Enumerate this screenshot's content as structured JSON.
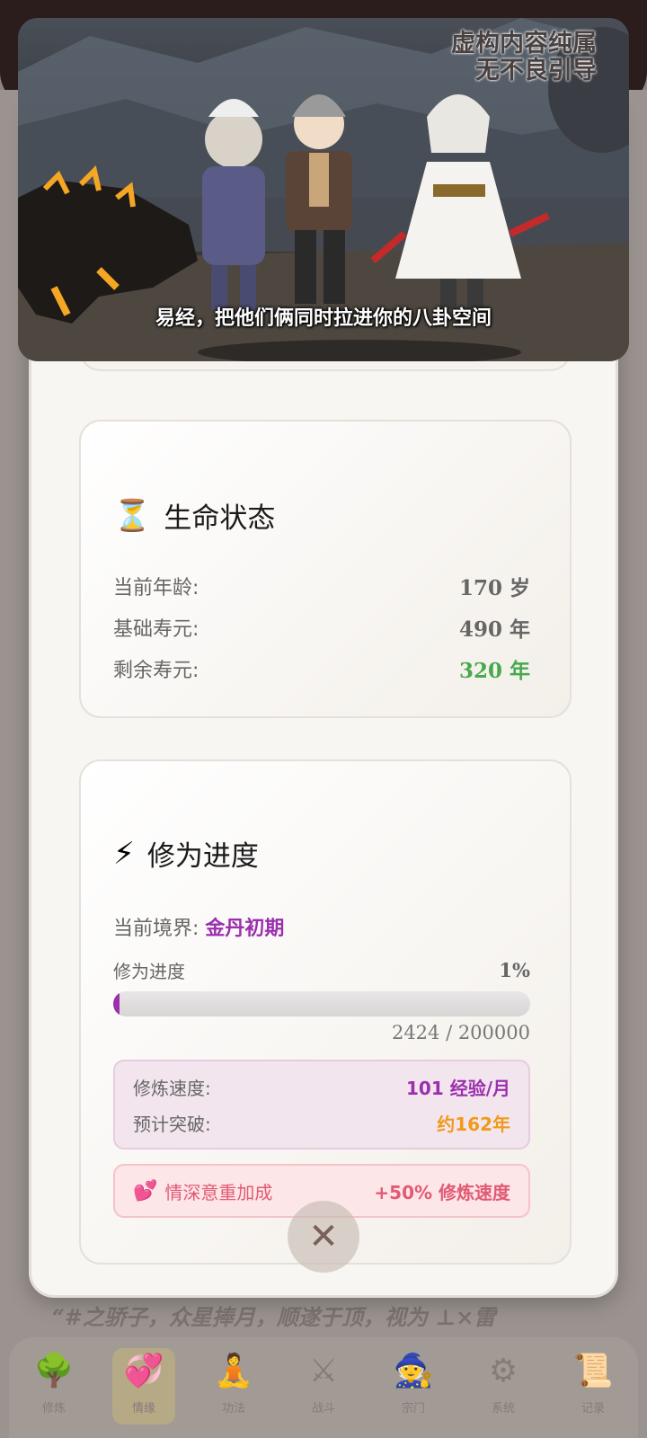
{
  "video": {
    "watermark_line1": "虚构内容纯属",
    "watermark_line2": "无不良引导",
    "subtitle": "易经，把他们俩同时拉进你的八卦空间"
  },
  "background": {
    "story_text": "“#之骄子，众星捧月，顺遂于顶，视为 ⊥×雷",
    "nav": [
      {
        "icon": "tree-icon",
        "glyph": "🌳",
        "label": "修炼"
      },
      {
        "icon": "heart-icon",
        "glyph": "💞",
        "label": "情缘"
      },
      {
        "icon": "person-icon",
        "glyph": "🧘",
        "label": "功法"
      },
      {
        "icon": "swords-icon",
        "glyph": "⚔",
        "label": "战斗"
      },
      {
        "icon": "wizard-icon",
        "glyph": "🧙",
        "label": "宗门"
      },
      {
        "icon": "gear-icon",
        "glyph": "⚙",
        "label": "系统"
      },
      {
        "icon": "scroll-icon",
        "glyph": "📜",
        "label": "记录"
      }
    ],
    "nav_active_index": 1
  },
  "life": {
    "icon": "hourglass-icon",
    "icon_glyph": "⏳",
    "title": "生命状态",
    "age_label": "当前年龄:",
    "age_value": "170 岁",
    "base_label": "基础寿元:",
    "base_value": "490 年",
    "remain_label": "剩余寿元:",
    "remain_value": "320 年",
    "remain_color": "#47a94e"
  },
  "cultivation": {
    "icon": "lightning-icon",
    "icon_glyph": "⚡",
    "title": "修为进度",
    "realm_label": "当前境界:",
    "realm_value": "金丹初期",
    "progress_label": "修为进度",
    "progress_percent_text": "1%",
    "progress_fraction": 0.012,
    "exp_text": "2424 / 200000",
    "speed_label": "修炼速度:",
    "speed_value": "101 经验/月",
    "eta_label": "预计突破:",
    "eta_value": "约162年",
    "bonus_icon": "hearts-icon",
    "bonus_glyph": "💕",
    "bonus_label": "情深意重加成",
    "bonus_value": "+50% 修炼速度",
    "accent_purple": "#9b2fae",
    "accent_orange": "#ef9a1a",
    "accent_pink": "#e25a75"
  },
  "close_glyph": "✕"
}
